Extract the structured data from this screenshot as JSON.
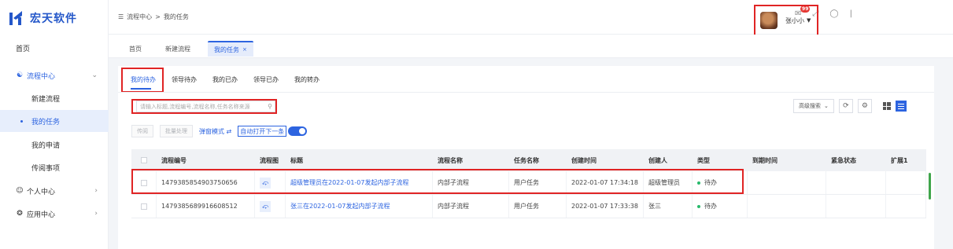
{
  "app": {
    "logo_text": "宏天软件"
  },
  "sidebar": {
    "items": [
      {
        "label": "首页"
      },
      {
        "label": "流程中心"
      },
      {
        "label": "新建流程"
      },
      {
        "label": "我的任务"
      },
      {
        "label": "我的申请"
      },
      {
        "label": "传阅事项"
      },
      {
        "label": "个人中心"
      },
      {
        "label": "应用中心"
      }
    ]
  },
  "header": {
    "breadcrumb": [
      "流程中心",
      "我的任务"
    ],
    "notification_count": "99",
    "user_name": "张小小"
  },
  "page_tabs": [
    {
      "label": "首页"
    },
    {
      "label": "新建流程"
    },
    {
      "label": "我的任务"
    }
  ],
  "sub_tabs": [
    {
      "label": "我的待办"
    },
    {
      "label": "领导待办"
    },
    {
      "label": "我的已办"
    },
    {
      "label": "领导已办"
    },
    {
      "label": "我的转办"
    }
  ],
  "search": {
    "placeholder": "请输入标题,流程编号,流程名称,任务名称来源"
  },
  "toolbar": {
    "advanced_search": "高级搜索",
    "transfer": "传阅",
    "batch": "批量处理",
    "popup_mode": "弹窗模式",
    "auto_open_next": "自动打开下一条"
  },
  "table": {
    "columns": [
      "流程编号",
      "流程图",
      "标题",
      "流程名称",
      "任务名称",
      "创建时间",
      "创建人",
      "类型",
      "到期时间",
      "紧急状态",
      "扩展1"
    ],
    "rows": [
      {
        "id": "1479385854903750656",
        "title": "超级管理员在2022-01-07发起内部子流程",
        "flow_name": "内部子流程",
        "task_name": "用户任务",
        "created": "2022-01-07 17:34:18",
        "creator": "超级管理员",
        "type": "待办"
      },
      {
        "id": "1479385689916608512",
        "title": "张三在2022-01-07发起内部子流程",
        "flow_name": "内部子流程",
        "task_name": "用户任务",
        "created": "2022-01-07 17:33:38",
        "creator": "张三",
        "type": "待办"
      }
    ]
  },
  "colors": {
    "accent": "#2d64e0",
    "highlight": "#e02424",
    "status_ok": "#27b96b"
  }
}
